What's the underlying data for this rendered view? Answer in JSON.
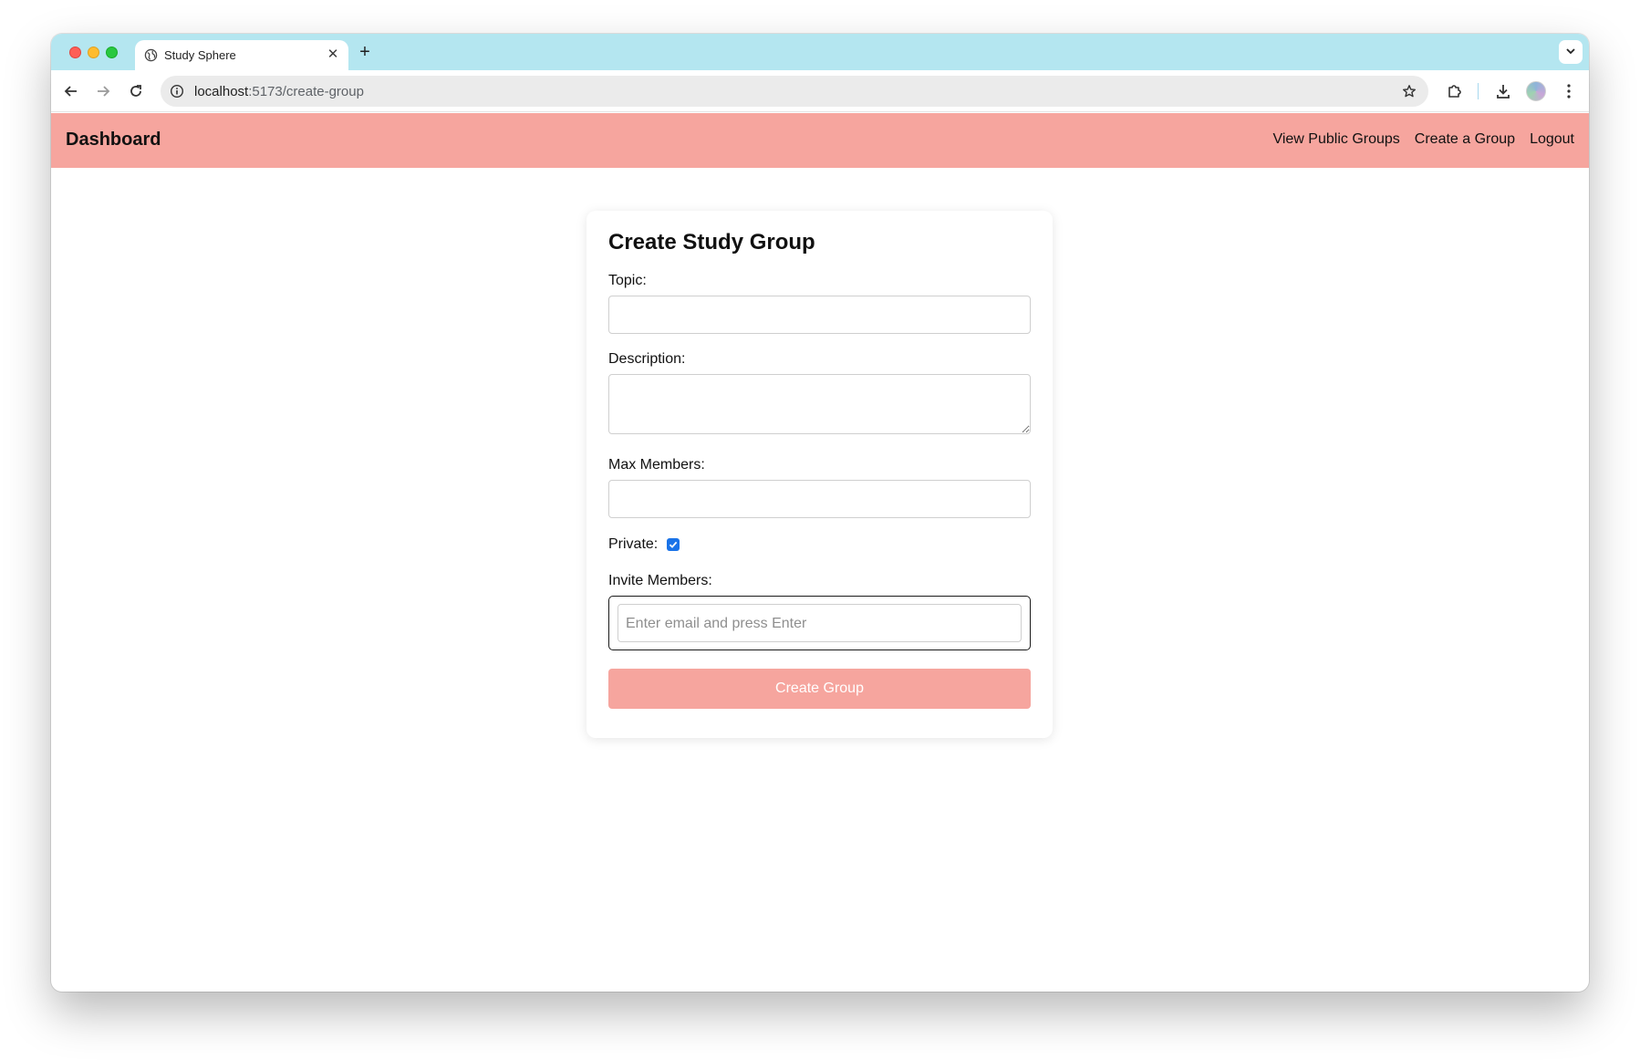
{
  "browser": {
    "tab_title": "Study Sphere",
    "url_host": "localhost",
    "url_path": ":5173/create-group"
  },
  "nav": {
    "brand": "Dashboard",
    "links": [
      "View Public Groups",
      "Create a Group",
      "Logout"
    ]
  },
  "form": {
    "title": "Create Study Group",
    "topic_label": "Topic:",
    "topic_value": "",
    "description_label": "Description:",
    "description_value": "",
    "max_members_label": "Max Members:",
    "max_members_value": "",
    "private_label": "Private:",
    "private_checked": true,
    "invite_label": "Invite Members:",
    "invite_placeholder": "Enter email and press Enter",
    "submit_label": "Create Group"
  },
  "colors": {
    "tabstrip": "#b4e6f0",
    "nav_bg": "#f6a59e",
    "button_bg": "#f6a59e",
    "checkbox": "#1a73e8"
  }
}
